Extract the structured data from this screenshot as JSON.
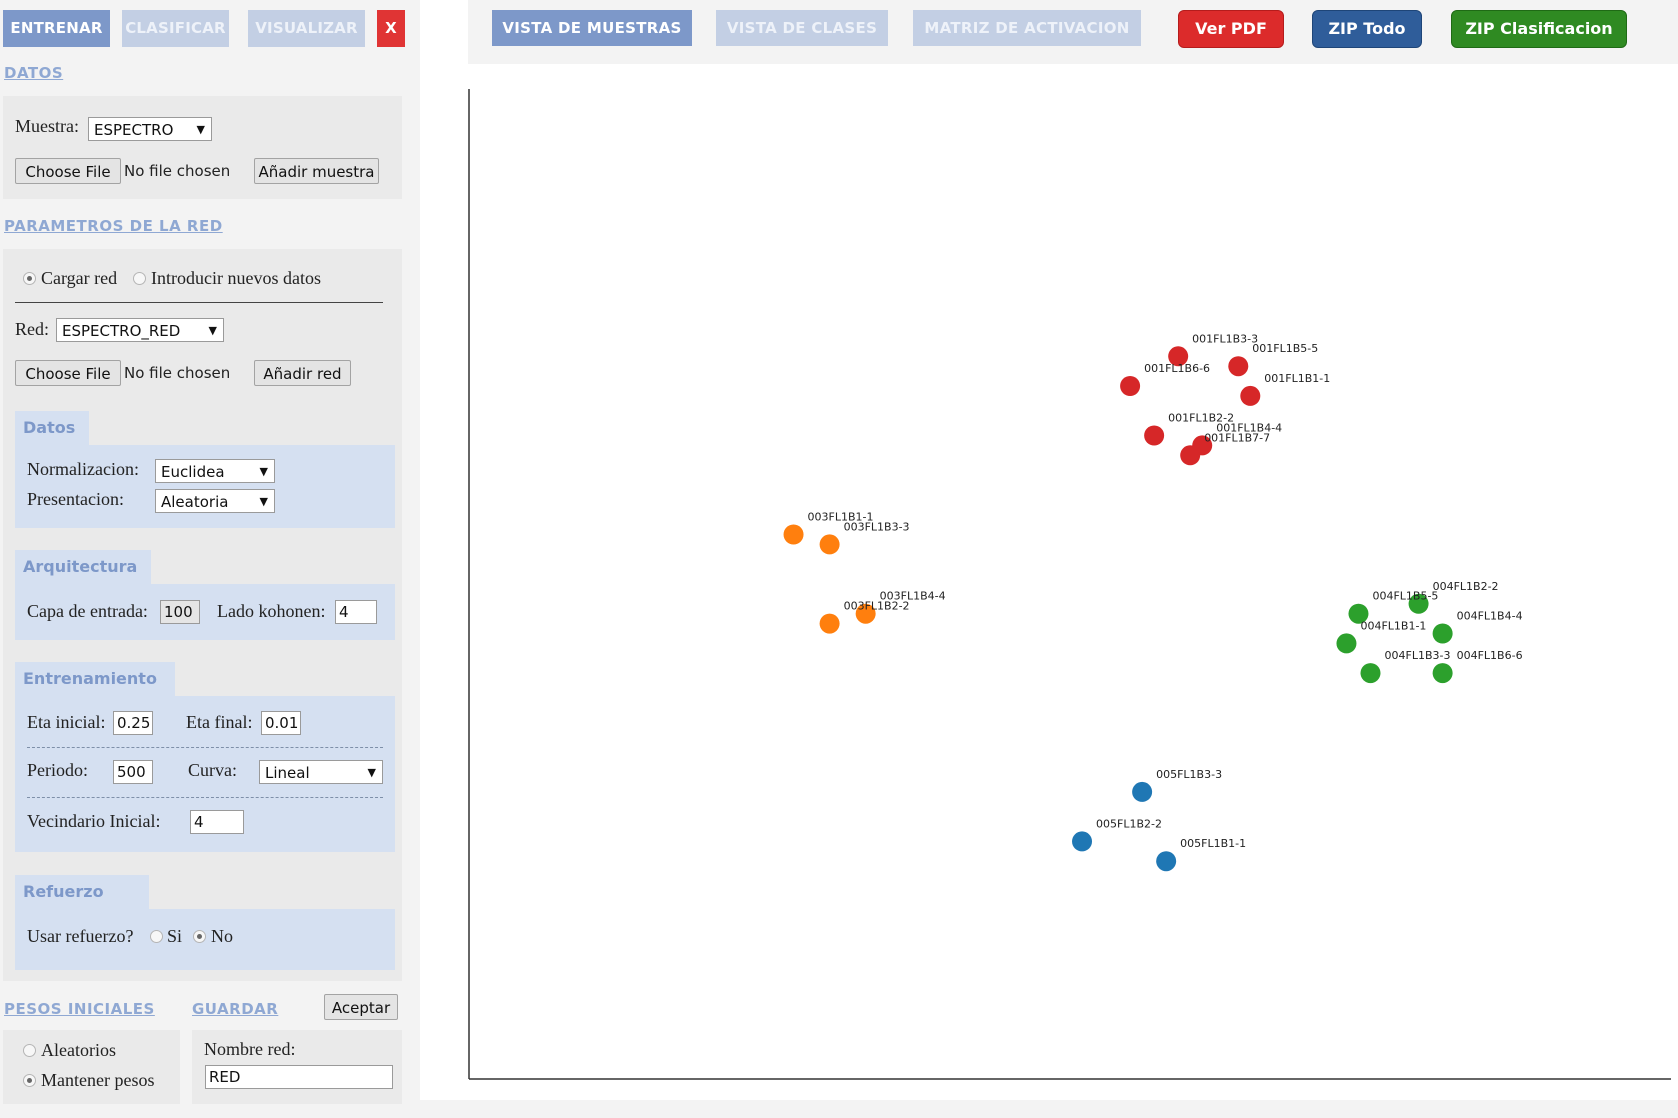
{
  "tabs": {
    "train": "ENTRENAR",
    "classify": "CLASIFICAR",
    "visualize": "VISUALIZAR",
    "close": "X"
  },
  "datos_section": {
    "link": "DATOS",
    "muestra_label": "Muestra:",
    "muestra_value": "ESPECTRO",
    "choose_file": "Choose File",
    "no_file": "No file chosen",
    "add_sample": "Añadir muestra"
  },
  "network_params": {
    "link": "PARAMETROS DE LA RED",
    "radio_load": "Cargar red",
    "radio_new": "Introducir nuevos datos",
    "red_label": "Red:",
    "red_value": "ESPECTRO_RED",
    "choose_file": "Choose File",
    "no_file": "No file chosen",
    "add_net": "Añadir red",
    "datos": {
      "title": "Datos",
      "norm_label": "Normalizacion:",
      "norm_value": "Euclidea",
      "pres_label": "Presentacion:",
      "pres_value": "Aleatoria"
    },
    "arquitectura": {
      "title": "Arquitectura",
      "input_label": "Capa de entrada:",
      "input_value": "100",
      "side_label": "Lado kohonen:",
      "side_value": "4"
    },
    "entrenamiento": {
      "title": "Entrenamiento",
      "eta_ini_label": "Eta inicial:",
      "eta_ini_value": "0.25",
      "eta_fin_label": "Eta final:",
      "eta_fin_value": "0.01",
      "period_label": "Periodo:",
      "period_value": "500",
      "curve_label": "Curva:",
      "curve_value": "Lineal",
      "neigh_label": "Vecindario Inicial:",
      "neigh_value": "4"
    },
    "refuerzo": {
      "title": "Refuerzo",
      "question": "Usar refuerzo?",
      "yes": "Si",
      "no": "No"
    }
  },
  "pesos": {
    "link": "PESOS INICIALES",
    "random": "Aleatorios",
    "keep": "Mantener pesos"
  },
  "guardar": {
    "link": "GUARDAR",
    "accept": "Aceptar",
    "name_label": "Nombre red:",
    "name_value": "RED"
  },
  "toolbar": {
    "samples_view": "VISTA DE MUESTRAS",
    "classes_view": "VISTA DE CLASES",
    "activation_matrix": "MATRIZ DE ACTIVACION",
    "view_pdf": "Ver PDF",
    "zip_all": "ZIP Todo",
    "zip_class": "ZIP Clasificacion"
  },
  "colors": {
    "active_tab": "#7d98c9",
    "inactive_tab": "#c3cfe4",
    "close": "#e03434",
    "pdf": "#dc2b2b",
    "zip_all": "#2f5d9a",
    "zip_class": "#2f8a22",
    "class_001": "#d62728",
    "class_003": "#ff7f0e",
    "class_004": "#2ca02c",
    "class_005": "#1f77b4"
  },
  "chart_data": {
    "type": "scatter",
    "title": "",
    "xlabel": "",
    "ylabel": "",
    "grid": false,
    "series": [
      {
        "color": "#d62728",
        "points": [
          {
            "x": 0.59,
            "y": 0.73,
            "label": "001FL1B3-3"
          },
          {
            "x": 0.64,
            "y": 0.72,
            "label": "001FL1B5-5"
          },
          {
            "x": 0.55,
            "y": 0.7,
            "label": "001FL1B6-6"
          },
          {
            "x": 0.65,
            "y": 0.69,
            "label": "001FL1B1-1"
          },
          {
            "x": 0.57,
            "y": 0.65,
            "label": "001FL1B2-2"
          },
          {
            "x": 0.61,
            "y": 0.64,
            "label": "001FL1B4-4"
          },
          {
            "x": 0.6,
            "y": 0.63,
            "label": "001FL1B7-7"
          }
        ]
      },
      {
        "color": "#ff7f0e",
        "points": [
          {
            "x": 0.27,
            "y": 0.55,
            "label": "003FL1B1-1"
          },
          {
            "x": 0.3,
            "y": 0.54,
            "label": "003FL1B3-3"
          },
          {
            "x": 0.33,
            "y": 0.47,
            "label": "003FL1B4-4"
          },
          {
            "x": 0.3,
            "y": 0.46,
            "label": "003FL1B2-2"
          }
        ]
      },
      {
        "color": "#2ca02c",
        "points": [
          {
            "x": 0.79,
            "y": 0.48,
            "label": "004FL1B2-2"
          },
          {
            "x": 0.74,
            "y": 0.47,
            "label": "004FL1B5-5"
          },
          {
            "x": 0.81,
            "y": 0.45,
            "label": "004FL1B4-4"
          },
          {
            "x": 0.73,
            "y": 0.44,
            "label": "004FL1B1-1"
          },
          {
            "x": 0.81,
            "y": 0.41,
            "label": "004FL1B6-6"
          },
          {
            "x": 0.75,
            "y": 0.41,
            "label": "004FL1B3-3"
          }
        ]
      },
      {
        "color": "#1f77b4",
        "points": [
          {
            "x": 0.56,
            "y": 0.29,
            "label": "005FL1B3-3"
          },
          {
            "x": 0.51,
            "y": 0.24,
            "label": "005FL1B2-2"
          },
          {
            "x": 0.58,
            "y": 0.22,
            "label": "005FL1B1-1"
          }
        ]
      }
    ]
  }
}
